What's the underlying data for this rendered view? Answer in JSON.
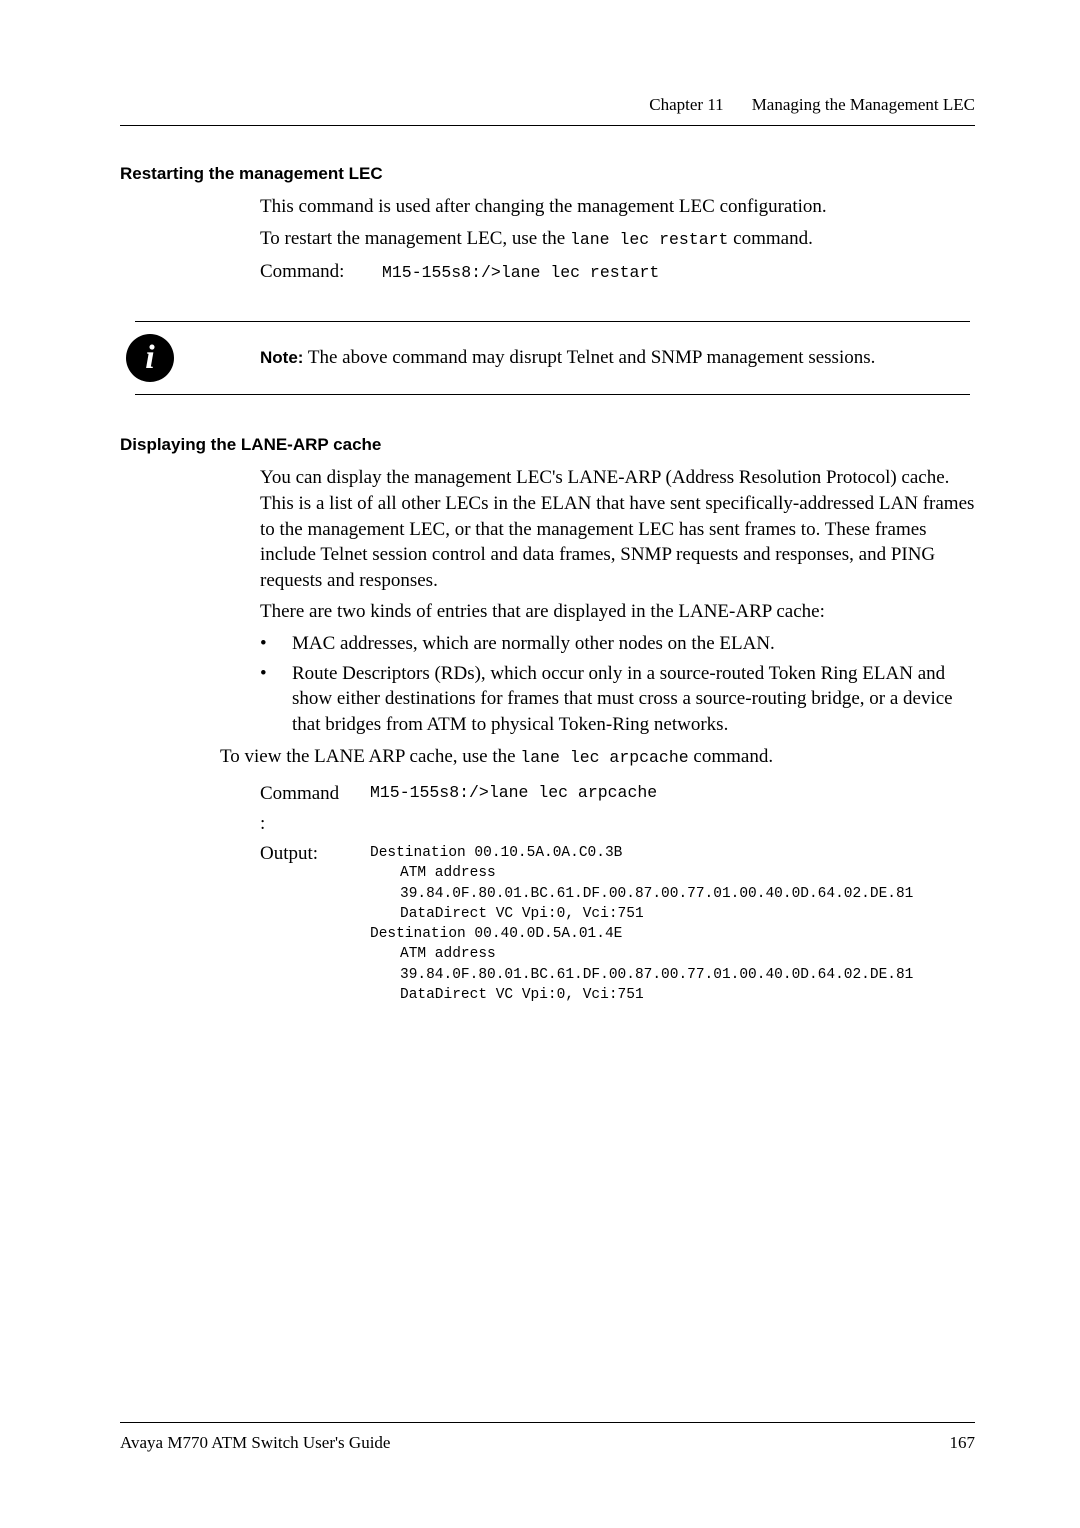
{
  "header": {
    "chapter": "Chapter 11",
    "title": "Managing the Management LEC"
  },
  "section1": {
    "heading": "Restarting the management LEC",
    "p1": "This command is used after changing the management LEC configuration.",
    "p2_part1": "To restart the management LEC, use the ",
    "p2_mono": "lane lec restart",
    "p2_part2": " command.",
    "cmd_label": "Command:",
    "cmd_text": "M15-155s8:/>lane lec restart"
  },
  "note": {
    "label": "Note:",
    "text": " The above command may disrupt Telnet and SNMP management sessions."
  },
  "section2": {
    "heading": "Displaying the LANE-ARP cache",
    "p1": "You can display the management LEC's LANE-ARP (Address Resolution Protocol) cache. This is a list of all other LECs in the ELAN that have sent specifically-addressed LAN frames to the management LEC, or that the management LEC has sent frames to. These frames include Telnet session control and data frames, SNMP requests and responses, and PING requests and responses.",
    "p2": "There are two kinds of entries that are displayed in the LANE-ARP cache:",
    "bullets": [
      "MAC addresses, which are normally other nodes on the ELAN.",
      "Route Descriptors (RDs), which occur only in a source-routed Token Ring ELAN and show either destinations for frames that must cross a source-routing bridge, or a device that bridges from ATM to physical Token-Ring networks."
    ],
    "p3_part1": "To view the LANE ARP cache, use the ",
    "p3_mono": "lane lec arpcache",
    "p3_part2": " command.",
    "cmd_label_line1": "Command",
    "cmd_label_line2": ":",
    "cmd_text": "M15-155s8:/>lane lec arpcache",
    "out_label": "Output:",
    "output_lines": [
      {
        "indent": false,
        "text": "Destination  00.10.5A.0A.C0.3B"
      },
      {
        "indent": true,
        "text": "ATM address  39.84.0F.80.01.BC.61.DF.00.87.00.77.01.00.40.0D.64.02.DE.81"
      },
      {
        "indent": true,
        "text": "DataDirect VC Vpi:0, Vci:751"
      },
      {
        "indent": false,
        "text": "Destination  00.40.0D.5A.01.4E"
      },
      {
        "indent": true,
        "text": "ATM address  39.84.0F.80.01.BC.61.DF.00.87.00.77.01.00.40.0D.64.02.DE.81"
      },
      {
        "indent": true,
        "text": "DataDirect VC Vpi:0, Vci:751"
      }
    ]
  },
  "footer": {
    "left": "Avaya M770 ATM Switch User's Guide",
    "right": "167"
  }
}
